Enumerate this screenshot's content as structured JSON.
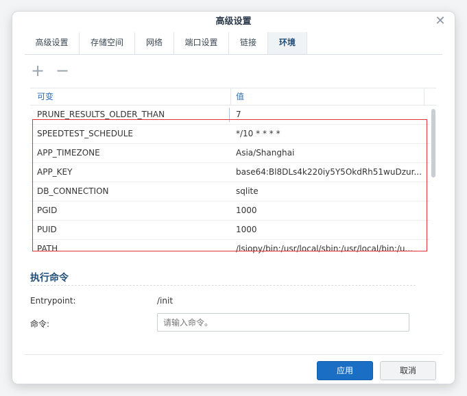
{
  "dialog": {
    "title": "高级设置"
  },
  "tabs": [
    {
      "label": "高级设置"
    },
    {
      "label": "存储空间"
    },
    {
      "label": "网络"
    },
    {
      "label": "端口设置"
    },
    {
      "label": "链接"
    },
    {
      "label": "环境"
    }
  ],
  "active_tab": "环境",
  "toolbar": {
    "add_icon": "plus-icon",
    "remove_icon": "minus-icon"
  },
  "env_table": {
    "headers": {
      "variable": "可变",
      "value": "值"
    },
    "rows": [
      {
        "key": "PRUNE_RESULTS_OLDER_THAN",
        "value": "7"
      },
      {
        "key": "SPEEDTEST_SCHEDULE",
        "value": "*/10 * * * *"
      },
      {
        "key": "APP_TIMEZONE",
        "value": "Asia/Shanghai"
      },
      {
        "key": "APP_KEY",
        "value": "base64:Bl8DLs4k220iy5Y5OkdRh51wuDzur..."
      },
      {
        "key": "DB_CONNECTION",
        "value": "sqlite"
      },
      {
        "key": "PGID",
        "value": "1000"
      },
      {
        "key": "PUID",
        "value": "1000"
      },
      {
        "key": "PATH",
        "value": "/lsiopy/bin:/usr/local/sbin:/usr/local/bin:/u..."
      }
    ]
  },
  "exec": {
    "section_title": "执行命令",
    "entrypoint_label": "Entrypoint:",
    "entrypoint_value": "/init",
    "command_label": "命令:",
    "command_placeholder": "请输入命令。",
    "command_value": ""
  },
  "buttons": {
    "apply": "应用",
    "cancel": "取消"
  },
  "colors": {
    "accent": "#1a6fc4",
    "highlight_border": "#e0303a",
    "header_text": "#2b6cb0"
  }
}
